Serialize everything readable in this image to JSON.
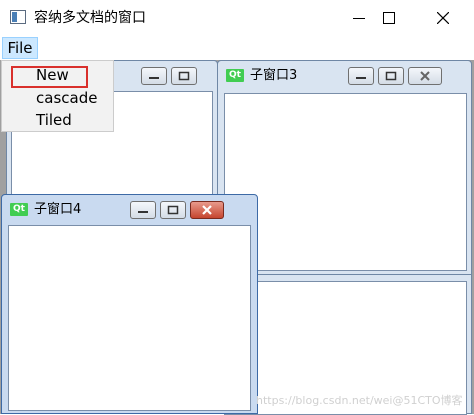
{
  "window": {
    "title": "容纳多文档的窗口",
    "minimize_icon": "minimize-icon",
    "maximize_icon": "maximize-icon",
    "close_icon": "close-icon"
  },
  "menubar": {
    "file_label": "File"
  },
  "file_menu": {
    "items": [
      "New",
      "cascade",
      "Tiled"
    ],
    "highlighted": "New"
  },
  "subwindows": [
    {
      "title": "",
      "icon": "qt-icon",
      "state": "inactive"
    },
    {
      "title": "子窗口3",
      "icon": "qt-icon",
      "state": "inactive"
    },
    {
      "title": "子窗口4",
      "icon": "qt-icon",
      "state": "active"
    },
    {
      "title": "",
      "icon": "",
      "state": "inactive"
    }
  ],
  "qt_icon_text": "Qt",
  "watermark": "https://blog.csdn.net/wei@51CTO博客",
  "colors": {
    "menu_hover": "#cce8ff",
    "highlight_border": "#d9302c",
    "qt_green": "#41cd52",
    "close_active": "#c5452f"
  }
}
